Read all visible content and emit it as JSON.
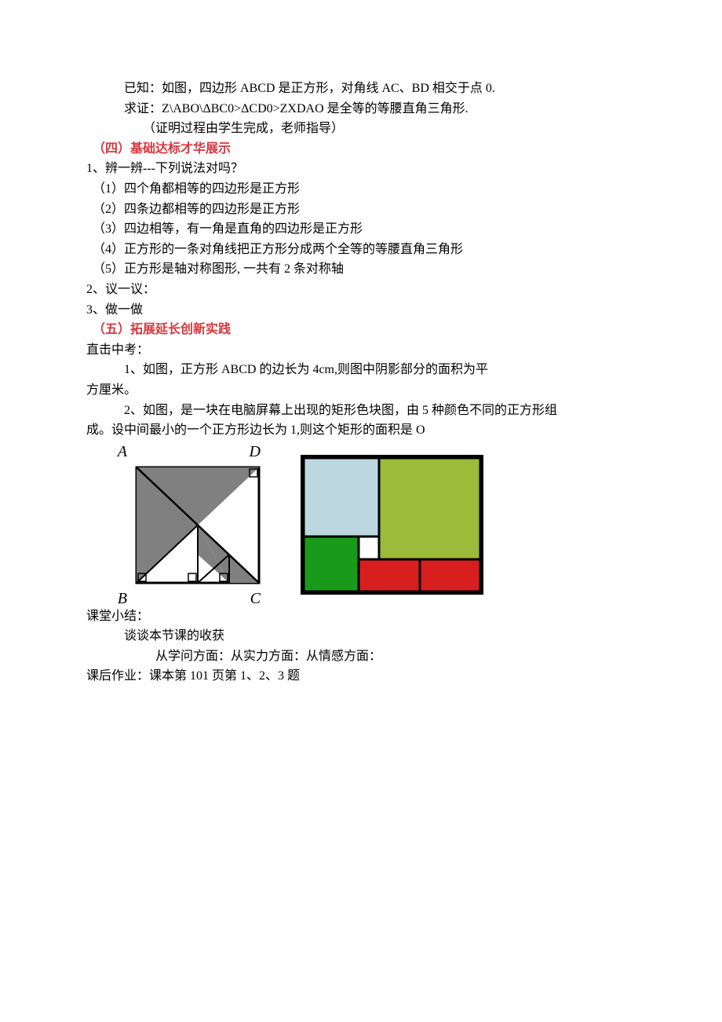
{
  "intro": {
    "known": "已知：如图，四边形 ABCD 是正方形，对角线 AC、BD 相交于点 0.",
    "prove": "求证：Z\\ABO\\ΔBC0>ΔCD0>ZXDAO 是全等的等腰直角三角形.",
    "note": "（证明过程由学生完成，老师指导）"
  },
  "section4": {
    "title": "（四）基础达标才华展示",
    "q1_lead": "1、辨一辨---下列说法对吗？",
    "items": [
      "（1）四个角都相等的四边形是正方形",
      "（2）四条边都相等的四边形是正方形",
      "（3）四边相等，有一角是直角的四边形是正方形",
      "（4）正方形的一条对角线把正方形分成两个全等的等腰直角三角形",
      "（5）正方形是轴对称图形, 一共有 2 条对称轴"
    ],
    "q2": "2、议一议：",
    "q3": "3、做一做"
  },
  "section5": {
    "title": "（五）拓展延长创新实践",
    "lead": "直击中考：",
    "p1a": "1、如图，正方形 ABCD 的边长为 4cm,则图中阴影部分的面积为平",
    "p1b": "方厘米。",
    "p2a": "2、如图，是一块在电脑屏幕上出现的矩形色块图，由 5 种颜色不同的正方形组",
    "p2b": "成。设中间最小的一个正方形边长为 1,则这个矩形的面积是 O"
  },
  "figure1": {
    "labels": {
      "A": "A",
      "B": "B",
      "C": "C",
      "D": "D"
    },
    "colors": {
      "shade": "#808080",
      "line": "#000000"
    }
  },
  "figure2": {
    "colors": {
      "border": "#000000",
      "topLeft": "#bdd7e0",
      "topRight": "#9bbb3a",
      "bottomLeft": "#1a9a1a",
      "smallCenter": "#ffffff",
      "red": "#d81f1f"
    }
  },
  "closing": {
    "summary_title": "课堂小结：",
    "summary_line": "谈谈本节课的收获",
    "aspects": "从学问方面：从实力方面：从情感方面：",
    "homework": "课后作业：课本第 101 页第 1、2、3 题"
  }
}
